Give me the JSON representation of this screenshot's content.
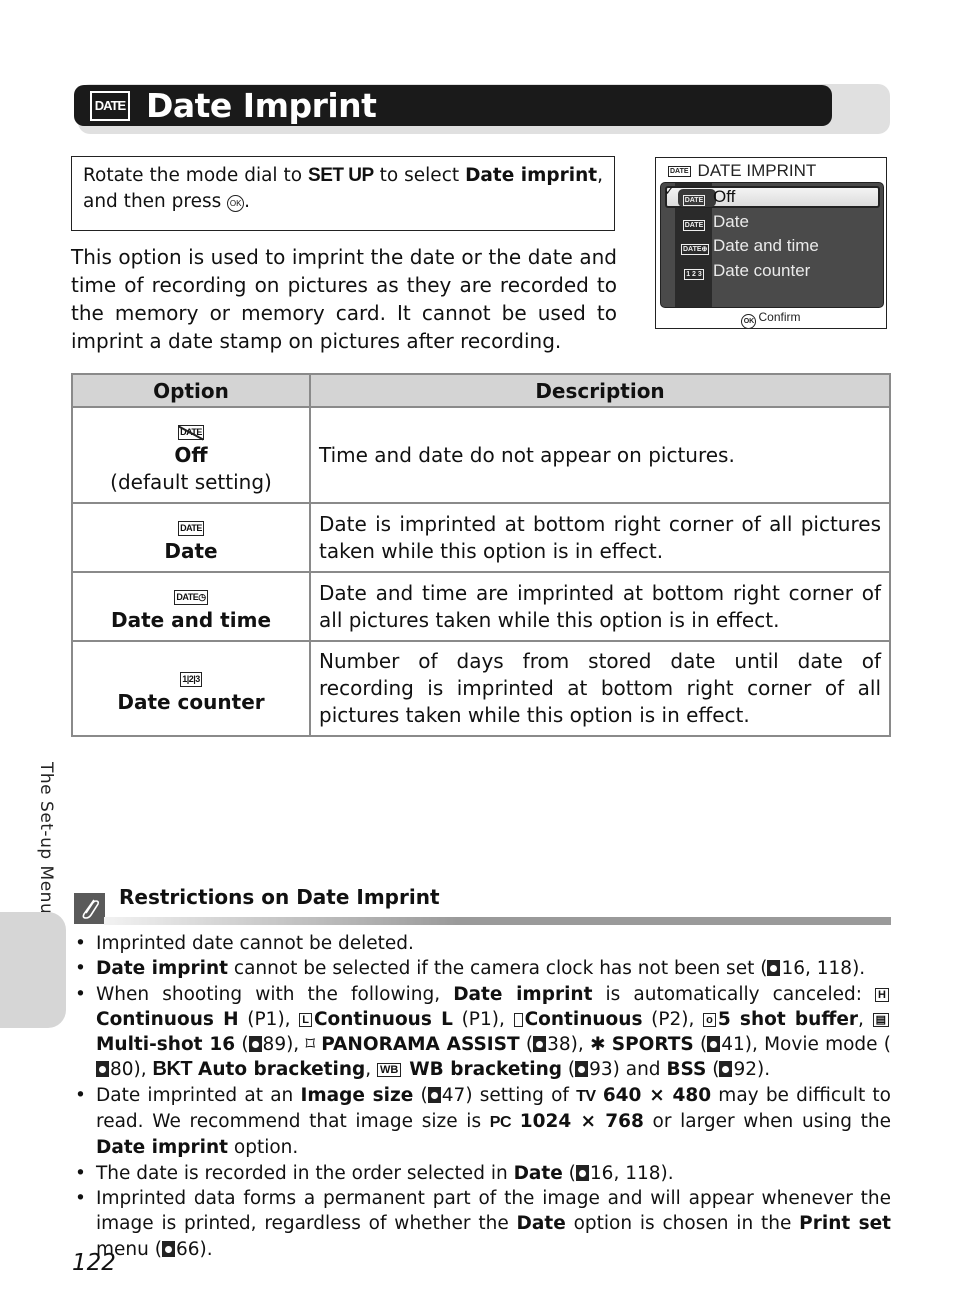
{
  "header": {
    "icon_label": "DATE",
    "title": "Date Imprint"
  },
  "instruction": {
    "part1": "Rotate the mode dial to ",
    "mode": "SET UP",
    "part2": " to select ",
    "bold_target": "Date imprint",
    "part3": ", and then press ",
    "button": "OK",
    "part4": "."
  },
  "intro": "This option is used to imprint the date or the date and time of recording on pictures as they are recorded to the memory or memory card. It cannot be used to imprint a date stamp on pictures after recording.",
  "camera_screen": {
    "title": "DATE IMPRINT",
    "title_icon": "DATE",
    "items": [
      {
        "icon": "DATE",
        "label": "Off",
        "selected": true
      },
      {
        "icon": "DATE",
        "label": "Date",
        "selected": false
      },
      {
        "icon": "DATE⊕",
        "label": "Date and time",
        "selected": false
      },
      {
        "icon": "1 2 3",
        "label": "Date counter",
        "selected": false
      }
    ],
    "check": "✓",
    "confirm_button": "OK",
    "confirm_label": "Confirm"
  },
  "table": {
    "headers": [
      "Option",
      "Description"
    ],
    "rows": [
      {
        "icon": "DATE",
        "name": "Off",
        "note": "(default setting)",
        "description": "Time and date do not appear on pictures."
      },
      {
        "icon": "DATE",
        "name": "Date",
        "note": "",
        "description": "Date is imprinted at bottom right corner of all pictures taken while this option is in effect."
      },
      {
        "icon": "DATE◷",
        "name": "Date and time",
        "note": "",
        "description": "Date and time are imprinted at bottom right corner of all pictures taken while this option is in effect."
      },
      {
        "icon": "1|2|3",
        "name": "Date counter",
        "note": "",
        "description": "Number of days from stored date until date of recording is imprinted at bottom right corner of all pictures taken while this option is in effect."
      }
    ]
  },
  "side_tab": {
    "label": "The Set-up Menu"
  },
  "restrictions": {
    "title": "Restrictions on Date Imprint",
    "icon": "paperclip-icon",
    "b1": "Imprinted date cannot be deleted.",
    "b2": {
      "bold": "Date imprint",
      "text": " cannot be selected if the camera clock has not been set (",
      "ref": "16, 118",
      "end": ")."
    },
    "b3": {
      "t1": "When shooting with the following, ",
      "bold1": "Date imprint",
      "t2": " is automatically canceled: ",
      "cont_h": "Continuous H",
      "cont_h_page": " (P1), ",
      "cont_l": "Continuous L",
      "cont_l_page": " (P1), ",
      "cont": "Continuous",
      "cont_page": " (P2), ",
      "buffer": "5 shot buffer",
      "buffer_end": ", ",
      "multishot": "Multi-shot 16",
      "multishot_ref": "89",
      "panorama": "PANORAMA ASSIST",
      "panorama_ref": "38",
      "sports": "SPORTS",
      "sports_ref": "41",
      "movie": ", Movie mode (",
      "movie_ref": "80",
      "bkt_icon": "BKT",
      "bkt": "Auto bracketing",
      "wb_icon": "WB",
      "wb": "WB bracketing",
      "wb_ref": "93",
      "and": " and ",
      "bss": "BSS",
      "bss_ref": "92"
    },
    "b4": {
      "t1": "Date imprinted at an ",
      "bold1": "Image size",
      "ref1": "47",
      "t2": ") setting of ",
      "tv_icon": "TV",
      "bold2": "640 × 480",
      "t3": " may be difficult to read. We recommend that image size is ",
      "pc_icon": "PC",
      "bold3": "1024 × 768",
      "t4": " or larger when using the ",
      "bold4": "Date imprint",
      "t5": " option."
    },
    "b5": {
      "t1": "The date is recorded in the order selected in ",
      "bold1": "Date",
      "ref": "16, 118",
      "end": ")."
    },
    "b6": {
      "t1": "Imprinted data forms a permanent part of the image and will appear whenever the image is printed, regardless of whether the ",
      "bold1": "Date",
      "t2": " option is chosen in the ",
      "bold2": "Print set",
      "t3": " menu (",
      "ref": "66",
      "end": ")."
    }
  },
  "page_number": "122"
}
